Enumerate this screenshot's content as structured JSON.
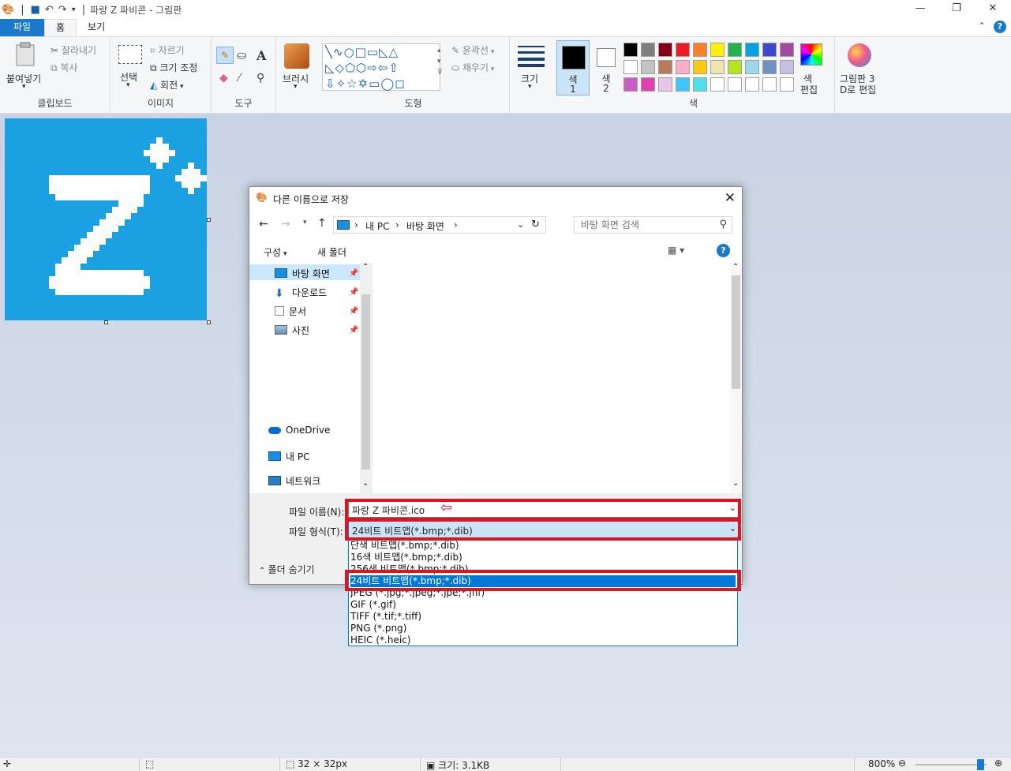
{
  "app": {
    "title": "파랑 Z 파비콘 - 그림판"
  },
  "tabs": {
    "file": "파일",
    "home": "홈",
    "view": "보기"
  },
  "ribbon": {
    "clipboard": {
      "paste": "붙여넣기",
      "cut": "잘라내기",
      "copy": "복사",
      "label": "클립보드"
    },
    "image": {
      "select": "선택",
      "crop": "자르기",
      "resize": "크기 조정",
      "rotate": "회전",
      "label": "이미지"
    },
    "tools": {
      "label": "도구"
    },
    "brushes": {
      "label": "브러시"
    },
    "shapes": {
      "outline": "윤곽선",
      "fill": "채우기",
      "label": "도형"
    },
    "size": {
      "label": "크기"
    },
    "colors": {
      "color1": "색",
      "color1_num": "1",
      "color2": "색",
      "color2_num": "2",
      "edit": "색",
      "edit2": "편집",
      "label": "색",
      "palette_row1": [
        "#000000",
        "#7f7f7f",
        "#880015",
        "#ed1c24",
        "#ff7f27",
        "#fff200",
        "#22b14c",
        "#00a2e8",
        "#3f48cc",
        "#a349a4"
      ],
      "palette_row2": [
        "#ffffff",
        "#c3c3c3",
        "#b97a57",
        "#ffaec9",
        "#ffc90e",
        "#efe4b0",
        "#b5e61d",
        "#99d9ea",
        "#7092be",
        "#c8bfe7"
      ],
      "palette_row3": [
        "#c85ec5",
        "#e040b0",
        "#e8c6e8",
        "#40c4ff",
        "#50e0e8",
        "#ffffff",
        "#ffffff",
        "#ffffff",
        "#ffffff",
        "#ffffff"
      ]
    },
    "paint3d": {
      "line1": "그림판 3",
      "line2": "D로 편집"
    }
  },
  "dialog": {
    "title": "다른 이름으로 저장",
    "breadcrumb": [
      "내 PC",
      "바탕 화면"
    ],
    "search_placeholder": "바탕 화면 검색",
    "organize": "구성",
    "new_folder": "새 폴더",
    "nav_items": [
      {
        "label": "바탕 화면",
        "icon": "desktop-icon"
      },
      {
        "label": "다운로드",
        "icon": "download-icon"
      },
      {
        "label": "문서",
        "icon": "document-icon"
      },
      {
        "label": "사진",
        "icon": "pictures-icon"
      }
    ],
    "nav_bottom": [
      {
        "label": "OneDrive",
        "icon": "onedrive-icon"
      },
      {
        "label": "내 PC",
        "icon": "pc-icon"
      },
      {
        "label": "네트워크",
        "icon": "network-icon"
      }
    ],
    "filename_label": "파일 이름(N):",
    "filename_value": "파랑 Z 파비콘.ico",
    "filetype_label": "파일 형식(T):",
    "filetype_value": "24비트 비트맵(*.bmp;*.dib)",
    "hide_folders": "폴더 숨기기",
    "filetype_options": [
      "단색 비트맵(*.bmp;*.dib)",
      "16색 비트맵(*.bmp;*.dib)",
      "256색 비트맵(*.bmp;*.dib)",
      "24비트 비트맵(*.bmp;*.dib)",
      "JPEG (*.jpg;*.jpeg;*.jpe;*.jfif)",
      "GIF (*.gif)",
      "TIFF (*.tif;*.tiff)",
      "PNG (*.png)",
      "HEIC (*.heic)"
    ],
    "selected_option_index": 3
  },
  "status": {
    "dimensions": "32 × 32px",
    "size": "크기: 3.1KB",
    "zoom": "800%"
  }
}
